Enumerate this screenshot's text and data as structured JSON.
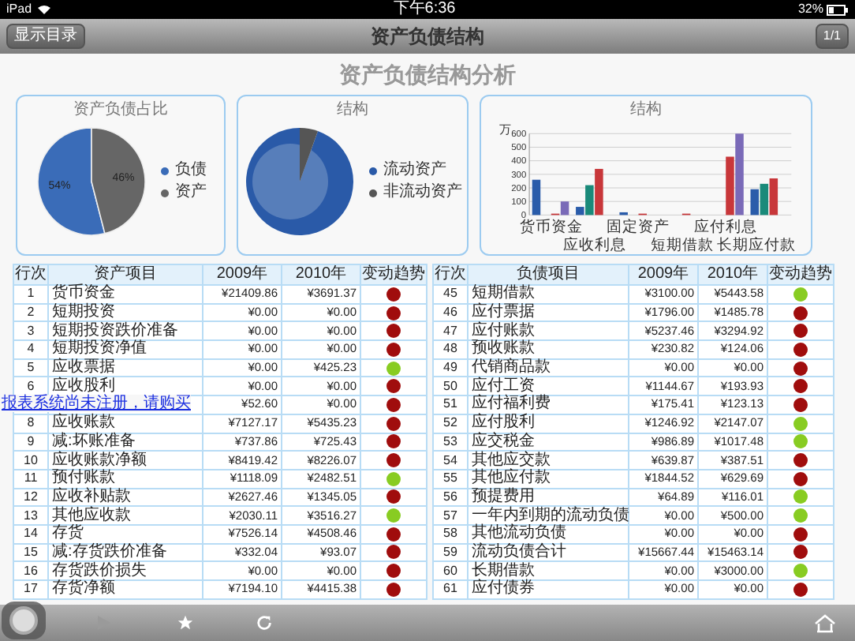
{
  "status_bar": {
    "device": "iPad",
    "time": "下午6:36",
    "battery": "32%"
  },
  "nav_bar": {
    "left_button": "显示目录",
    "title": "资产负债结构",
    "right_button": "1/1"
  },
  "page_title": "资产负债结构分析",
  "charts": [
    {
      "kind": "chart",
      "chart_data": {
        "type": "pie",
        "title": "资产负债占比",
        "categories": [
          "负债",
          "资产"
        ],
        "series": [
          {
            "values": [
              54,
              46
            ]
          }
        ],
        "value_labels": [
          "54%",
          "46%"
        ]
      },
      "slices": [
        {
          "color": "#3a6cb8"
        },
        {
          "color": "#666666"
        }
      ]
    },
    {
      "kind": "pie_picture",
      "title": "结构",
      "legend": [
        {
          "label": "流动资产",
          "color": "#2a5aa8"
        },
        {
          "label": "非流动资产",
          "color": "#555555"
        }
      ]
    },
    {
      "kind": "chart",
      "chart_data": {
        "type": "bar",
        "title": "结构",
        "ylabel": "万",
        "categories": [
          "货币资金",
          "应收利息",
          "固定资产",
          "短期借款",
          "应付利息",
          "长期应付款"
        ],
        "ylim": [
          0,
          600
        ],
        "yticks": [
          0,
          100,
          200,
          300,
          400,
          500,
          600
        ],
        "grid": true,
        "series": [
          {
            "color": "#2a5caa",
            "values": [
              260,
              60,
              20,
              0,
              0,
              190
            ]
          },
          {
            "color": "#1a8a7a",
            "values": [
              0,
              220,
              0,
              0,
              0,
              230
            ]
          },
          {
            "color": "#c8373a",
            "values": [
              10,
              340,
              10,
              10,
              430,
              270
            ]
          },
          {
            "color": "#7a6ab8",
            "values": [
              100,
              0,
              0,
              0,
              600,
              0
            ]
          }
        ]
      }
    }
  ],
  "notice_link": "报表系统尚未注册，请购买",
  "tables": [
    {
      "columns": [
        "行次",
        "资产项目",
        "2009年",
        "2010年",
        "变动趋势"
      ],
      "rows": [
        {
          "no": "1",
          "name": "货币资金",
          "y2009": "¥21409.86",
          "y2010": "¥3691.37",
          "color": "#a00d0d"
        },
        {
          "no": "2",
          "name": "短期投资",
          "y2009": "¥0.00",
          "y2010": "¥0.00",
          "color": "#a00d0d"
        },
        {
          "no": "3",
          "name": "短期投资跌价准备",
          "y2009": "¥0.00",
          "y2010": "¥0.00",
          "color": "#a00d0d"
        },
        {
          "no": "4",
          "name": "短期投资净值",
          "y2009": "¥0.00",
          "y2010": "¥0.00",
          "color": "#a00d0d"
        },
        {
          "no": "5",
          "name": "应收票据",
          "y2009": "¥0.00",
          "y2010": "¥425.23",
          "color": "#88cc22"
        },
        {
          "no": "6",
          "name": "应收股利",
          "y2009": "¥0.00",
          "y2010": "¥0.00",
          "color": "#a00d0d"
        },
        {
          "y2009": "¥52.60",
          "y2010": "¥0.00",
          "color": "#a00d0d"
        },
        {
          "no": "8",
          "name": "应收账款",
          "y2009": "¥7127.17",
          "y2010": "¥5435.23",
          "color": "#a00d0d"
        },
        {
          "no": "9",
          "name": "减:坏账准备",
          "y2009": "¥737.86",
          "y2010": "¥725.43",
          "color": "#a00d0d"
        },
        {
          "no": "10",
          "name": "应收账款净额",
          "y2009": "¥8419.42",
          "y2010": "¥8226.07",
          "color": "#a00d0d"
        },
        {
          "no": "11",
          "name": "预付账款",
          "y2009": "¥1118.09",
          "y2010": "¥2482.51",
          "color": "#88cc22"
        },
        {
          "no": "12",
          "name": "应收补贴款",
          "y2009": "¥2627.46",
          "y2010": "¥1345.05",
          "color": "#a00d0d"
        },
        {
          "no": "13",
          "name": "其他应收款",
          "y2009": "¥2030.11",
          "y2010": "¥3516.27",
          "color": "#88cc22"
        },
        {
          "no": "14",
          "name": "存货",
          "y2009": "¥7526.14",
          "y2010": "¥4508.46",
          "color": "#a00d0d"
        },
        {
          "no": "15",
          "name": "减:存货跌价准备",
          "y2009": "¥332.04",
          "y2010": "¥93.07",
          "color": "#a00d0d"
        },
        {
          "no": "16",
          "name": "存货跌价损失",
          "y2009": "¥0.00",
          "y2010": "¥0.00",
          "color": "#a00d0d"
        },
        {
          "no": "17",
          "name": "存货净额",
          "y2009": "¥7194.10",
          "y2010": "¥4415.38",
          "color": "#a00d0d"
        }
      ]
    },
    {
      "columns": [
        "行次",
        "负债项目",
        "2009年",
        "2010年",
        "变动趋势"
      ],
      "rows": [
        {
          "no": "45",
          "name": "短期借款",
          "y2009": "¥3100.00",
          "y2010": "¥5443.58",
          "color": "#88cc22"
        },
        {
          "no": "46",
          "name": "应付票据",
          "y2009": "¥1796.00",
          "y2010": "¥1485.78",
          "color": "#a00d0d"
        },
        {
          "no": "47",
          "name": "应付账款",
          "y2009": "¥5237.46",
          "y2010": "¥3294.92",
          "color": "#a00d0d"
        },
        {
          "no": "48",
          "name": "预收账款",
          "y2009": "¥230.82",
          "y2010": "¥124.06",
          "color": "#a00d0d"
        },
        {
          "no": "49",
          "name": "代销商品款",
          "y2009": "¥0.00",
          "y2010": "¥0.00",
          "color": "#a00d0d"
        },
        {
          "no": "50",
          "name": "应付工资",
          "y2009": "¥1144.67",
          "y2010": "¥193.93",
          "color": "#a00d0d"
        },
        {
          "no": "51",
          "name": "应付福利费",
          "y2009": "¥175.41",
          "y2010": "¥123.13",
          "color": "#a00d0d"
        },
        {
          "no": "52",
          "name": "应付股利",
          "y2009": "¥1246.92",
          "y2010": "¥2147.07",
          "color": "#88cc22"
        },
        {
          "no": "53",
          "name": "应交税金",
          "y2009": "¥986.89",
          "y2010": "¥1017.48",
          "color": "#88cc22"
        },
        {
          "no": "54",
          "name": "其他应交款",
          "y2009": "¥639.87",
          "y2010": "¥387.51",
          "color": "#a00d0d"
        },
        {
          "no": "55",
          "name": "其他应付款",
          "y2009": "¥1844.52",
          "y2010": "¥629.69",
          "color": "#a00d0d"
        },
        {
          "no": "56",
          "name": "预提费用",
          "y2009": "¥64.89",
          "y2010": "¥116.01",
          "color": "#88cc22"
        },
        {
          "no": "57",
          "name": "一年内到期的流动负债",
          "y2009": "¥0.00",
          "y2010": "¥500.00",
          "color": "#88cc22"
        },
        {
          "no": "58",
          "name": "其他流动负债",
          "y2009": "¥0.00",
          "y2010": "¥0.00",
          "color": "#a00d0d"
        },
        {
          "no": "59",
          "name": "流动负债合计",
          "y2009": "¥15667.44",
          "y2010": "¥15463.14",
          "color": "#a00d0d"
        },
        {
          "no": "60",
          "name": "长期借款",
          "y2009": "¥0.00",
          "y2010": "¥3000.00",
          "color": "#88cc22"
        },
        {
          "no": "61",
          "name": "应付债券",
          "y2009": "¥0.00",
          "y2010": "¥0.00",
          "color": "#a00d0d"
        }
      ]
    }
  ]
}
